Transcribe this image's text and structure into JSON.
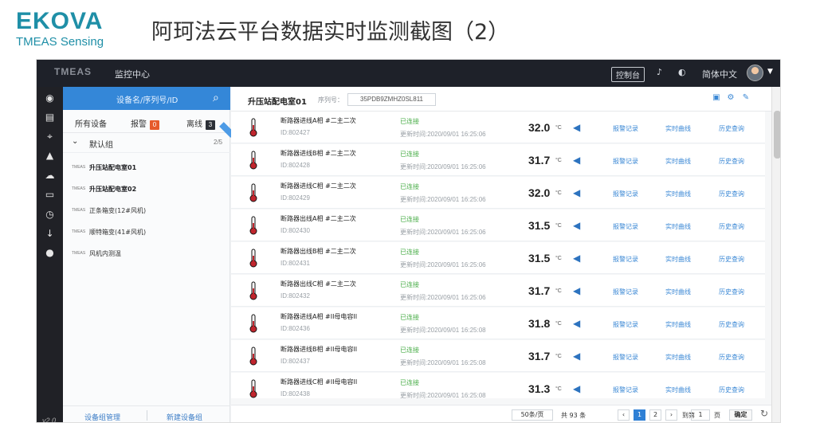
{
  "slide": {
    "logo_main": "EKOVA",
    "logo_sub": "TMEAS Sensing",
    "title": "阿珂法云平台数据实时监测截图（2）"
  },
  "topbar": {
    "brand": "TMEAS",
    "menu": "监控中心",
    "control_button": "控制台",
    "language": "简体中文",
    "icons": [
      "bell-icon",
      "palette-icon",
      "avatar"
    ]
  },
  "sidebar": {
    "items": [
      "dashboard-icon",
      "monitor-icon",
      "location-icon",
      "alert-icon",
      "cloud-icon",
      "card-icon",
      "time-icon",
      "download-icon",
      "user-icon"
    ],
    "version": "v2.0"
  },
  "device_panel": {
    "search_placeholder": "设备名/序列号/ID",
    "tabs": [
      {
        "label": "所有设备",
        "count": ""
      },
      {
        "label": "报警",
        "count": "0"
      },
      {
        "label": "离线",
        "count": "3"
      }
    ],
    "group": {
      "label": "默认组",
      "count": "2/5"
    },
    "devices": [
      {
        "tag": "TMEAS",
        "name": "升压站配电室01",
        "bold": true
      },
      {
        "tag": "TMEAS",
        "name": "升压站配电室02",
        "bold": true
      },
      {
        "tag": "TMEAS",
        "name": "正条箱变(12#风机)",
        "bold": false
      },
      {
        "tag": "TMEAS",
        "name": "顺特箱变(41#风机)",
        "bold": false
      },
      {
        "tag": "TMEAS",
        "name": "风机内测温",
        "bold": false
      }
    ],
    "footer": {
      "manage": "设备组管理",
      "new": "新建设备组"
    }
  },
  "station": {
    "name": "升压站配电室01",
    "serial_label": "序列号：",
    "serial": "35PDB9ZMHZ0SL811"
  },
  "sensors": [
    {
      "name": "断路器进线A相 #二主二次",
      "id": "ID:802427",
      "status": "已连接",
      "updated": "更新时间:2020/09/01 16:25:06",
      "value": "32.0"
    },
    {
      "name": "断路器进线B相 #二主二次",
      "id": "ID:802428",
      "status": "已连接",
      "updated": "更新时间:2020/09/01 16:25:06",
      "value": "31.7"
    },
    {
      "name": "断路器进线C相 #二主二次",
      "id": "ID:802429",
      "status": "已连接",
      "updated": "更新时间:2020/09/01 16:25:06",
      "value": "32.0"
    },
    {
      "name": "断路器出线A相 #二主二次",
      "id": "ID:802430",
      "status": "已连接",
      "updated": "更新时间:2020/09/01 16:25:06",
      "value": "31.5"
    },
    {
      "name": "断路器出线B相 #二主二次",
      "id": "ID:802431",
      "status": "已连接",
      "updated": "更新时间:2020/09/01 16:25:06",
      "value": "31.5"
    },
    {
      "name": "断路器出线C相 #二主二次",
      "id": "ID:802432",
      "status": "已连接",
      "updated": "更新时间:2020/09/01 16:25:06",
      "value": "31.7"
    },
    {
      "name": "断路器进线A相 #II母电容II",
      "id": "ID:802436",
      "status": "已连接",
      "updated": "更新时间:2020/09/01 16:25:08",
      "value": "31.8"
    },
    {
      "name": "断路器进线B相 #II母电容II",
      "id": "ID:802437",
      "status": "已连接",
      "updated": "更新时间:2020/09/01 16:25:08",
      "value": "31.7"
    },
    {
      "name": "断路器进线C相 #II母电容II",
      "id": "ID:802438",
      "status": "已连接",
      "updated": "更新时间:2020/09/01 16:25:08",
      "value": "31.3"
    }
  ],
  "row_labels": {
    "unit": "°C",
    "alarm_record": "报警记录",
    "realtime_curve": "实时曲线",
    "history_query": "历史查询"
  },
  "pager": {
    "page_size": "50条/页",
    "total": "共 93 条",
    "pages": [
      "1",
      "2"
    ],
    "goto_label": "到第",
    "goto_value": "1",
    "page_unit": "页",
    "confirm": "确定"
  },
  "colors": {
    "accent": "#3487d8",
    "dark": "#1e2129",
    "success": "#49ad48",
    "alarm": "#e65a2b"
  }
}
